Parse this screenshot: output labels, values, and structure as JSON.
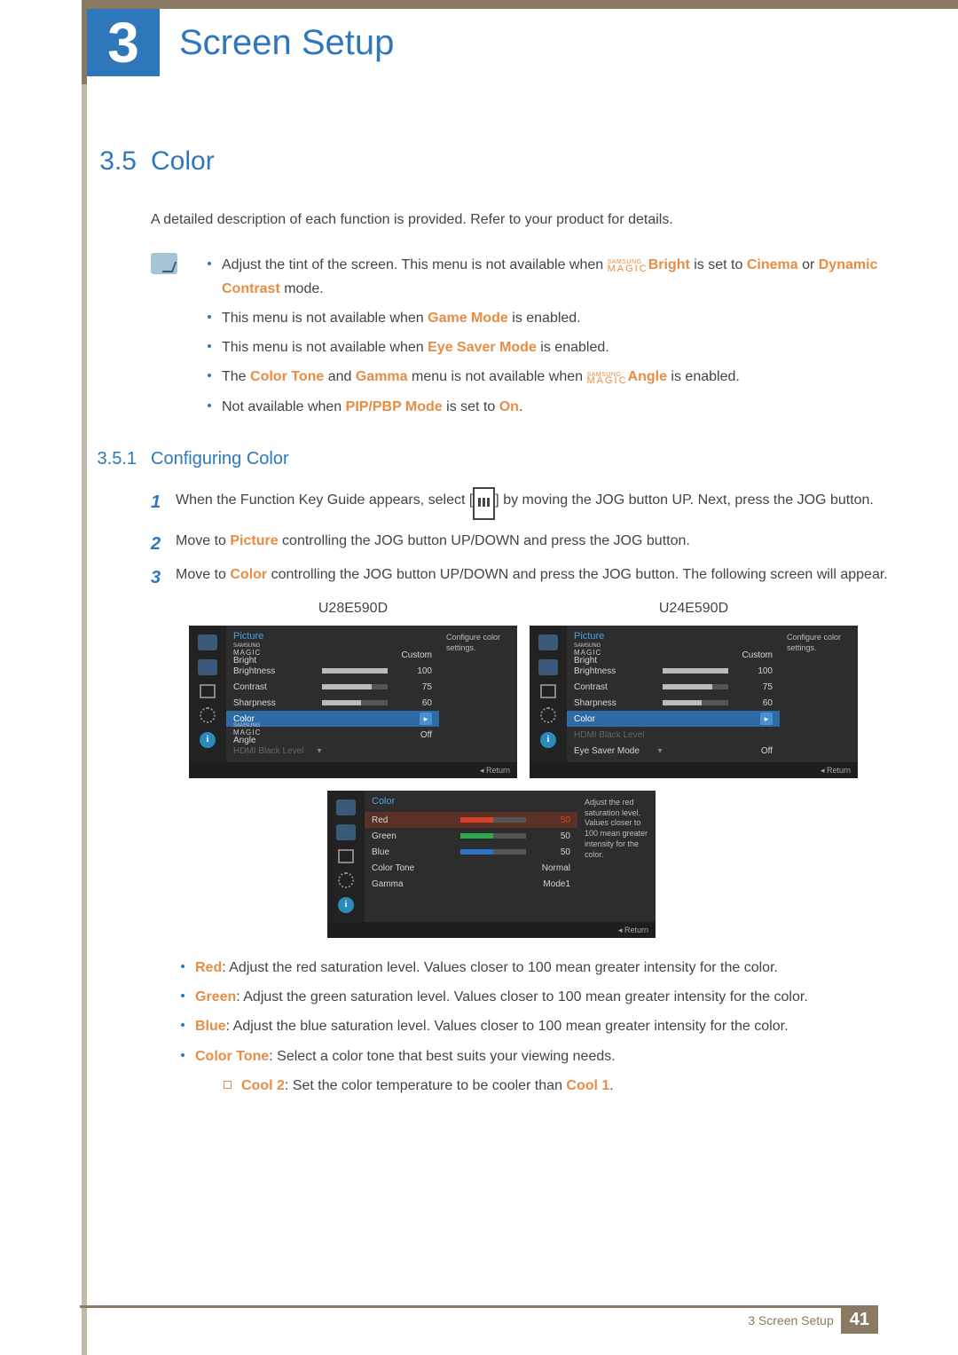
{
  "header": {
    "chapter_num": "3",
    "chapter_title": "Screen Setup"
  },
  "section": {
    "num": "3.5",
    "title": "Color"
  },
  "intro": "A detailed description of each function is provided. Refer to your product for details.",
  "notes": {
    "n1_a": "Adjust the tint of the screen. This menu is not available when ",
    "n1_brand_top": "SAMSUNG",
    "n1_brand_bot": "MAGIC",
    "n1_b": "Bright",
    "n1_c": " is set to ",
    "n1_d": "Cinema",
    "n1_e": " or ",
    "n1_f": "Dynamic Contrast",
    "n1_g": " mode.",
    "n2_a": "This menu is not available when ",
    "n2_b": "Game Mode",
    "n2_c": " is enabled.",
    "n3_a": "This menu is not available when ",
    "n3_b": "Eye Saver Mode",
    "n3_c": " is enabled.",
    "n4_a": "The ",
    "n4_b": "Color Tone",
    "n4_c": " and ",
    "n4_d": "Gamma",
    "n4_e": " menu is not available when ",
    "n4_f": "Angle",
    "n4_g": " is enabled.",
    "n5_a": "Not available when ",
    "n5_b": "PIP/PBP Mode",
    "n5_c": " is set to ",
    "n5_d": "On",
    "n5_e": "."
  },
  "subsection": {
    "num": "3.5.1",
    "title": "Configuring Color"
  },
  "steps": {
    "s1_a": "When the Function Key Guide appears, select [",
    "s1_b": "] by moving the JOG button UP. Next, press the JOG button.",
    "s2_a": "Move to ",
    "s2_b": "Picture",
    "s2_c": " controlling the JOG button UP/DOWN and press the JOG button.",
    "s3_a": "Move to ",
    "s3_b": "Color",
    "s3_c": " controlling the JOG button UP/DOWN and press the JOG button. The following screen will appear."
  },
  "osd_left": {
    "model": "U28E590D",
    "title": "Picture",
    "hint": "Configure color settings.",
    "rows": {
      "magic_bright_top": "SAMSUNG",
      "magic_bright_bot": "MAGIC",
      "magic_bright_lbl": "Bright",
      "magic_bright_val": "Custom",
      "brightness_lbl": "Brightness",
      "brightness_val": "100",
      "brightness_pct": 100,
      "contrast_lbl": "Contrast",
      "contrast_val": "75",
      "contrast_pct": 75,
      "sharpness_lbl": "Sharpness",
      "sharpness_val": "60",
      "sharpness_pct": 60,
      "color_lbl": "Color",
      "magic_angle_top": "SAMSUNG",
      "magic_angle_bot": "MAGIC",
      "magic_angle_lbl": "Angle",
      "magic_angle_val": "Off",
      "hdmi_lbl": "HDMI Black Level"
    },
    "return": "Return"
  },
  "osd_right": {
    "model": "U24E590D",
    "title": "Picture",
    "hint": "Configure color settings.",
    "rows": {
      "magic_bright_top": "SAMSUNG",
      "magic_bright_bot": "MAGIC",
      "magic_bright_lbl": "Bright",
      "magic_bright_val": "Custom",
      "brightness_lbl": "Brightness",
      "brightness_val": "100",
      "brightness_pct": 100,
      "contrast_lbl": "Contrast",
      "contrast_val": "75",
      "contrast_pct": 75,
      "sharpness_lbl": "Sharpness",
      "sharpness_val": "60",
      "sharpness_pct": 60,
      "color_lbl": "Color",
      "hdmi_lbl": "HDMI Black Level",
      "eye_lbl": "Eye Saver Mode",
      "eye_val": "Off"
    },
    "return": "Return"
  },
  "osd_color": {
    "title": "Color",
    "hint": "Adjust the red saturation level. Values closer to 100 mean greater intensity for the color.",
    "rows": {
      "red_lbl": "Red",
      "red_val": "50",
      "red_pct": 50,
      "green_lbl": "Green",
      "green_val": "50",
      "green_pct": 50,
      "blue_lbl": "Blue",
      "blue_val": "50",
      "blue_pct": 50,
      "tone_lbl": "Color Tone",
      "tone_val": "Normal",
      "gamma_lbl": "Gamma",
      "gamma_val": "Mode1"
    },
    "return": "Return"
  },
  "color_desc": {
    "red_lbl": "Red",
    "red_txt": ": Adjust the red saturation level. Values closer to 100 mean greater intensity for the color.",
    "green_lbl": "Green",
    "green_txt": ": Adjust the green saturation level. Values closer to 100 mean greater intensity for the color.",
    "blue_lbl": "Blue",
    "blue_txt": ": Adjust the blue saturation level. Values closer to 100 mean greater intensity for the color.",
    "tone_lbl": "Color Tone",
    "tone_txt": ": Select a color tone that best suits your viewing needs.",
    "cool2_lbl": "Cool 2",
    "cool2_a": ": Set the color temperature to be cooler than ",
    "cool2_b": "Cool 1",
    "cool2_c": "."
  },
  "footer": {
    "text": "3 Screen Setup",
    "page": "41"
  },
  "icon_info": "i"
}
